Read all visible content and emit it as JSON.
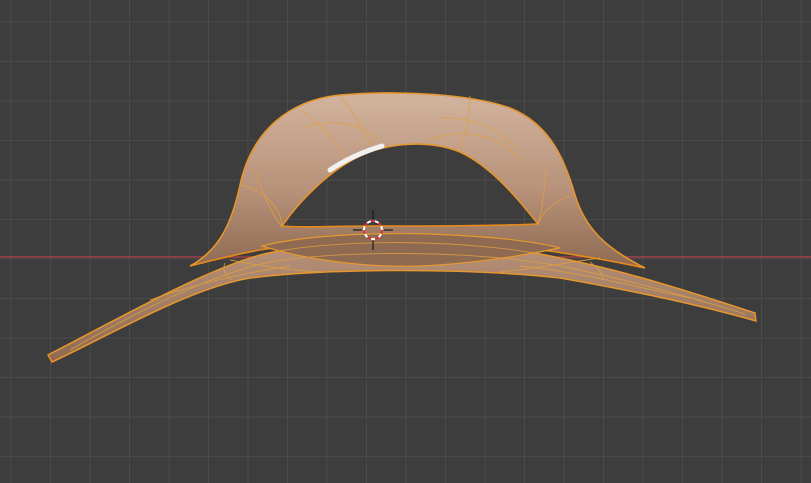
{
  "viewport": {
    "kind": "3d-viewport",
    "background_color": "#3d3d3d",
    "grid_color": "#4a4a4a",
    "x_axis_color": "#b5424d",
    "grid_visible": true
  },
  "object": {
    "kind": "mesh",
    "selected": true,
    "fill_color": "#b8927a",
    "fill_shadow_color": "#8e6a52",
    "fill_highlight_color": "#d2b49e",
    "outline_color": "#e88a1a",
    "wire_color": "#e0a040"
  },
  "active_edge": {
    "color": "#f0f0f0"
  },
  "cursor_3d": {
    "icon": "3d-cursor-icon",
    "ring_colors": [
      "#e03030",
      "#ffffff"
    ]
  }
}
